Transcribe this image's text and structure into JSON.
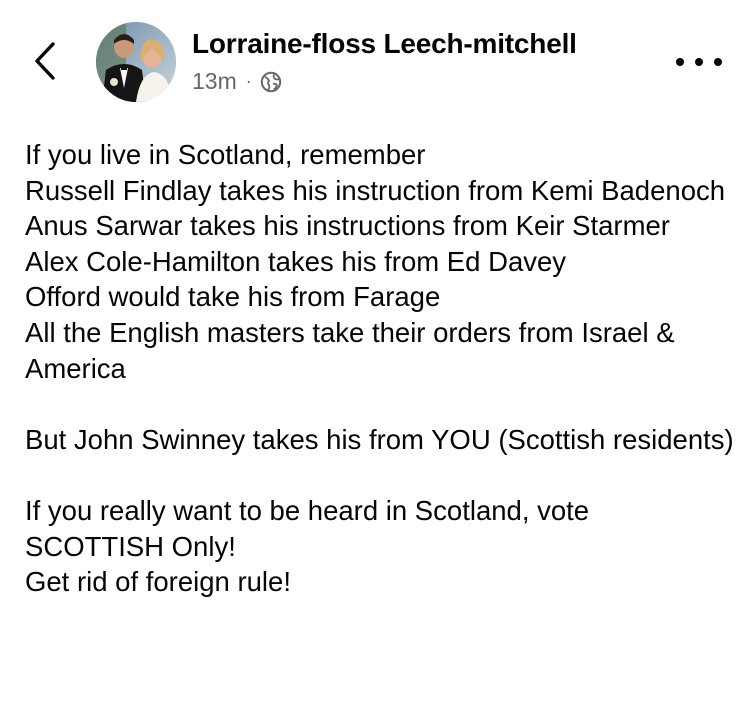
{
  "header": {
    "author_name": "Lorraine-floss Leech-mitchell",
    "timestamp": "13m",
    "separator": "·",
    "privacy_icon": "globe-icon",
    "back_icon": "chevron-left-icon",
    "more_icon": "more-horizontal-icon"
  },
  "post": {
    "paragraphs": [
      "If you live in Scotland, remember\nRussell Findlay takes his instruction from Kemi Badenoch\nAnus Sarwar takes his instructions from Keir Starmer\nAlex Cole-Hamilton takes his from Ed Davey\nOfford would take his from Farage\nAll the English masters take their orders from Israel & America",
      "But John Swinney takes his from YOU (Scottish residents)",
      "If you really want to be heard in Scotland, vote SCOTTISH Only!\nGet rid of foreign rule!"
    ]
  },
  "colors": {
    "text_primary": "#050505",
    "text_secondary": "#65676b",
    "background": "#ffffff"
  }
}
